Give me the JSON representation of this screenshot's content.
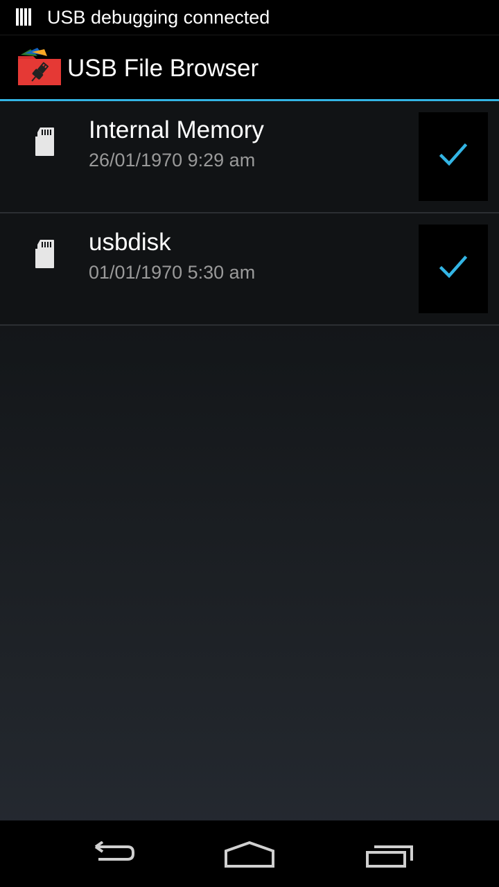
{
  "status_bar": {
    "notification_icon": "usb-debug-icon",
    "text": "USB debugging connected"
  },
  "action_bar": {
    "app_icon": "usb-folder-app-icon",
    "title": "USB File Browser"
  },
  "accent_color": "#33b5e5",
  "storage_list": [
    {
      "icon": "sd-card-icon",
      "name": "Internal Memory",
      "date": "26/01/1970 9:29 am",
      "checked": true
    },
    {
      "icon": "sd-card-icon",
      "name": "usbdisk",
      "date": "01/01/1970 5:30 am",
      "checked": true
    }
  ],
  "nav_bar": {
    "buttons": [
      "back-icon",
      "home-icon",
      "recent-apps-icon"
    ]
  }
}
